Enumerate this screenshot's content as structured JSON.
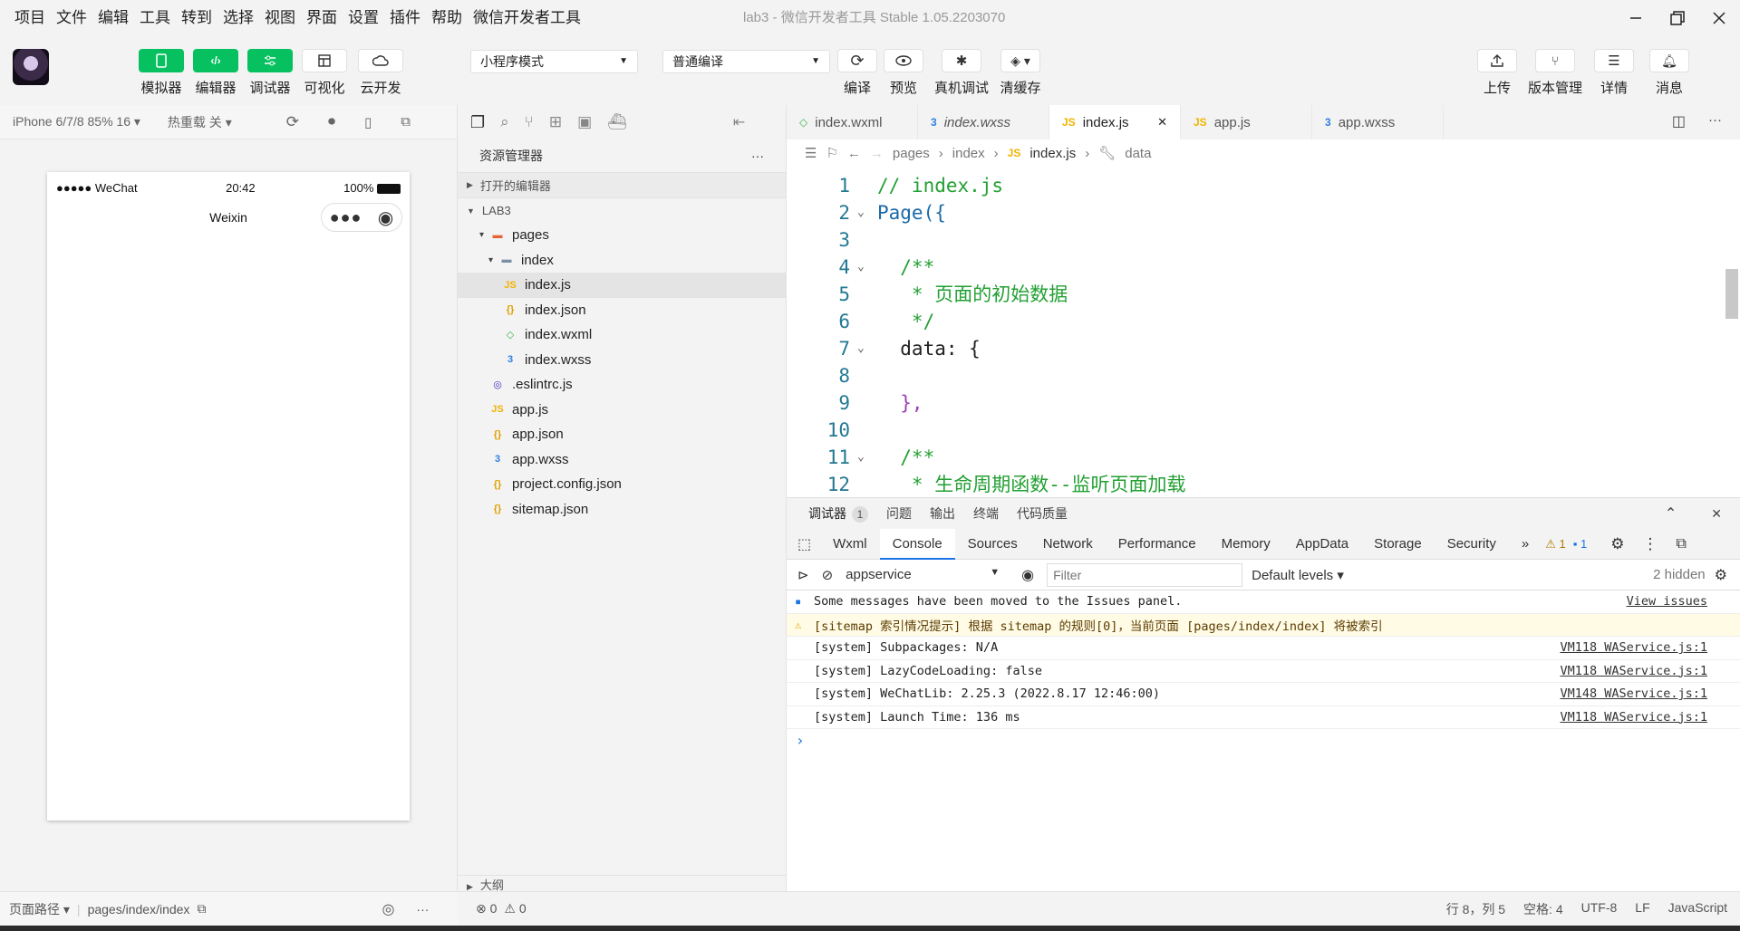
{
  "menu": [
    "项目",
    "文件",
    "编辑",
    "工具",
    "转到",
    "选择",
    "视图",
    "界面",
    "设置",
    "插件",
    "帮助",
    "微信开发者工具"
  ],
  "window_title": "lab3 - 微信开发者工具 Stable 1.05.2203070",
  "toolbar": {
    "simulator": "模拟器",
    "editor": "编辑器",
    "debugger": "调试器",
    "visual": "可视化",
    "cloud": "云开发",
    "mode": "小程序模式",
    "compile_mode": "普通编译",
    "compile": "编译",
    "preview": "预览",
    "real_debug": "真机调试",
    "clear_cache": "清缓存",
    "upload": "上传",
    "version": "版本管理",
    "details": "详情",
    "messages": "消息"
  },
  "simulator": {
    "device": "iPhone 6/7/8 85% 16 ▾",
    "hot_reload": "热重载 关 ▾",
    "status_signal": "●●●●● WeChat",
    "time": "20:42",
    "battery": "100%",
    "nav_title": "Weixin"
  },
  "sim_bottom": {
    "path_label": "页面路径 ▾",
    "path": "pages/index/index"
  },
  "explorer": {
    "title": "资源管理器",
    "open_editors": "打开的编辑器",
    "project": "LAB3",
    "outline": "大纲",
    "tree": [
      {
        "name": "pages",
        "depth": 1,
        "type": "folder-red",
        "arrow": "▾"
      },
      {
        "name": "index",
        "depth": 2,
        "type": "folder",
        "arrow": "▾"
      },
      {
        "name": "index.js",
        "depth": 3,
        "type": "js",
        "arrow": ""
      },
      {
        "name": "index.json",
        "depth": 3,
        "type": "json",
        "arrow": ""
      },
      {
        "name": "index.wxml",
        "depth": 3,
        "type": "wxml",
        "arrow": ""
      },
      {
        "name": "index.wxss",
        "depth": 3,
        "type": "wxss",
        "arrow": ""
      },
      {
        "name": ".eslintrc.js",
        "depth": 1,
        "type": "eslint",
        "arrow": ""
      },
      {
        "name": "app.js",
        "depth": 1,
        "type": "js",
        "arrow": ""
      },
      {
        "name": "app.json",
        "depth": 1,
        "type": "json",
        "arrow": ""
      },
      {
        "name": "app.wxss",
        "depth": 1,
        "type": "wxss",
        "arrow": ""
      },
      {
        "name": "project.config.json",
        "depth": 1,
        "type": "json",
        "arrow": ""
      },
      {
        "name": "sitemap.json",
        "depth": 1,
        "type": "json",
        "arrow": ""
      }
    ]
  },
  "tabs": [
    {
      "name": "index.wxml",
      "type": "wxml",
      "active": false
    },
    {
      "name": "index.wxss",
      "type": "wxss",
      "active": false
    },
    {
      "name": "index.js",
      "type": "js",
      "active": true
    },
    {
      "name": "app.js",
      "type": "js",
      "active": false
    },
    {
      "name": "app.wxss",
      "type": "wxss",
      "active": false
    }
  ],
  "breadcrumb": [
    "pages",
    "index",
    "index.js",
    "data"
  ],
  "code_lines": [
    {
      "n": "1",
      "fold": "",
      "text": "// index.js",
      "cls": "c-comment"
    },
    {
      "n": "2",
      "fold": "⌄",
      "text": "Page({",
      "cls": "c-fn"
    },
    {
      "n": "3",
      "fold": "",
      "text": "",
      "cls": ""
    },
    {
      "n": "4",
      "fold": "⌄",
      "text": "  /**",
      "cls": "c-comment"
    },
    {
      "n": "5",
      "fold": "",
      "text": "   * 页面的初始数据",
      "cls": "c-comment"
    },
    {
      "n": "6",
      "fold": "",
      "text": "   */",
      "cls": "c-comment"
    },
    {
      "n": "7",
      "fold": "⌄",
      "text": "  data: {",
      "cls": ""
    },
    {
      "n": "8",
      "fold": "",
      "text": "",
      "cls": ""
    },
    {
      "n": "9",
      "fold": "",
      "text": "  },",
      "cls": "c-brace"
    },
    {
      "n": "10",
      "fold": "",
      "text": "",
      "cls": ""
    },
    {
      "n": "11",
      "fold": "⌄",
      "text": "  /**",
      "cls": "c-comment"
    },
    {
      "n": "12",
      "fold": "",
      "text": "   * 生命周期函数--监听页面加载",
      "cls": "c-comment"
    }
  ],
  "debugger": {
    "tabs": [
      "调试器",
      "问题",
      "输出",
      "终端",
      "代码质量"
    ],
    "badge": "1",
    "devtools_tabs": [
      "Wxml",
      "Console",
      "Sources",
      "Network",
      "Performance",
      "Memory",
      "AppData",
      "Storage",
      "Security"
    ],
    "more_tabs": "»",
    "warn_count": "1",
    "info_count": "1",
    "context": "appservice",
    "filter_placeholder": "Filter",
    "levels": "Default levels ▾",
    "hidden": "2 hidden",
    "messages": [
      {
        "text": "Some messages have been moved to the Issues panel.",
        "src": "View issues",
        "kind": "info"
      },
      {
        "text": "[sitemap 索引情况提示] 根据 sitemap 的规则[0]，当前页面 [pages/index/index] 将被索引",
        "src": "",
        "kind": "warn"
      },
      {
        "text": "[system] Subpackages: N/A",
        "src": "VM118 WAService.js:1",
        "kind": ""
      },
      {
        "text": "[system] LazyCodeLoading: false",
        "src": "VM118 WAService.js:1",
        "kind": ""
      },
      {
        "text": "[system] WeChatLib: 2.25.3 (2022.8.17 12:46:00)",
        "src": "VM148 WAService.js:1",
        "kind": ""
      },
      {
        "text": "[system] Launch Time: 136 ms",
        "src": "VM118 WAService.js:1",
        "kind": ""
      }
    ],
    "prompt": "›"
  },
  "status": {
    "errors": "⊗ 0",
    "warnings": "⚠ 0",
    "position": "行 8，列 5",
    "spaces": "空格: 4",
    "encoding": "UTF-8",
    "eol": "LF",
    "language": "JavaScript"
  },
  "colors": {
    "green": "#07c160",
    "js": "#f0b400",
    "wxml": "#39b54a",
    "wxss": "#2f7fe0",
    "json": "#e0a000"
  }
}
